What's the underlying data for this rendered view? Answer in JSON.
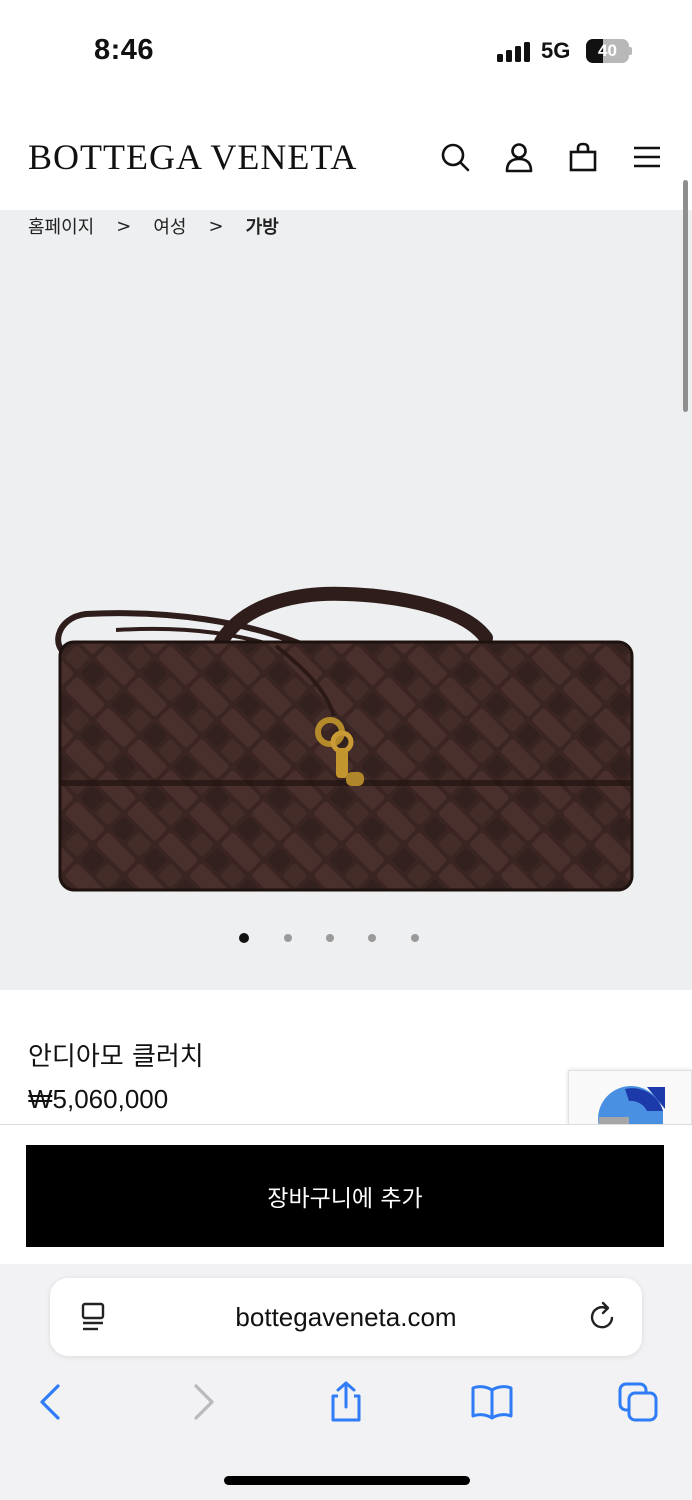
{
  "status_bar": {
    "time": "8:46",
    "network": "5G",
    "battery": "40",
    "battery_level": 0.4
  },
  "header": {
    "logo": "BOTTEGA VENETA",
    "icons": [
      "search-icon",
      "account-icon",
      "bag-icon",
      "menu-icon"
    ]
  },
  "breadcrumb": {
    "items": [
      "홈페이지",
      "여성",
      "가방"
    ],
    "separator": ">"
  },
  "product": {
    "name": "안디아모 클러치",
    "price": "₩5,060,000",
    "image": "woven-leather-clutch-image",
    "image_count": 5,
    "active_image": 1
  },
  "cart": {
    "button_label": "장바구니에 추가"
  },
  "browser": {
    "url": "bottegaveneta.com",
    "toolbar_icons": [
      "back-icon",
      "forward-icon",
      "share-icon",
      "bookmarks-icon",
      "tabs-icon"
    ]
  },
  "colors": {
    "gallery_bg": "#eeeff0",
    "button_bg": "#000000",
    "button_text": "#ffffff",
    "link_blue": "#2f7cf6"
  }
}
